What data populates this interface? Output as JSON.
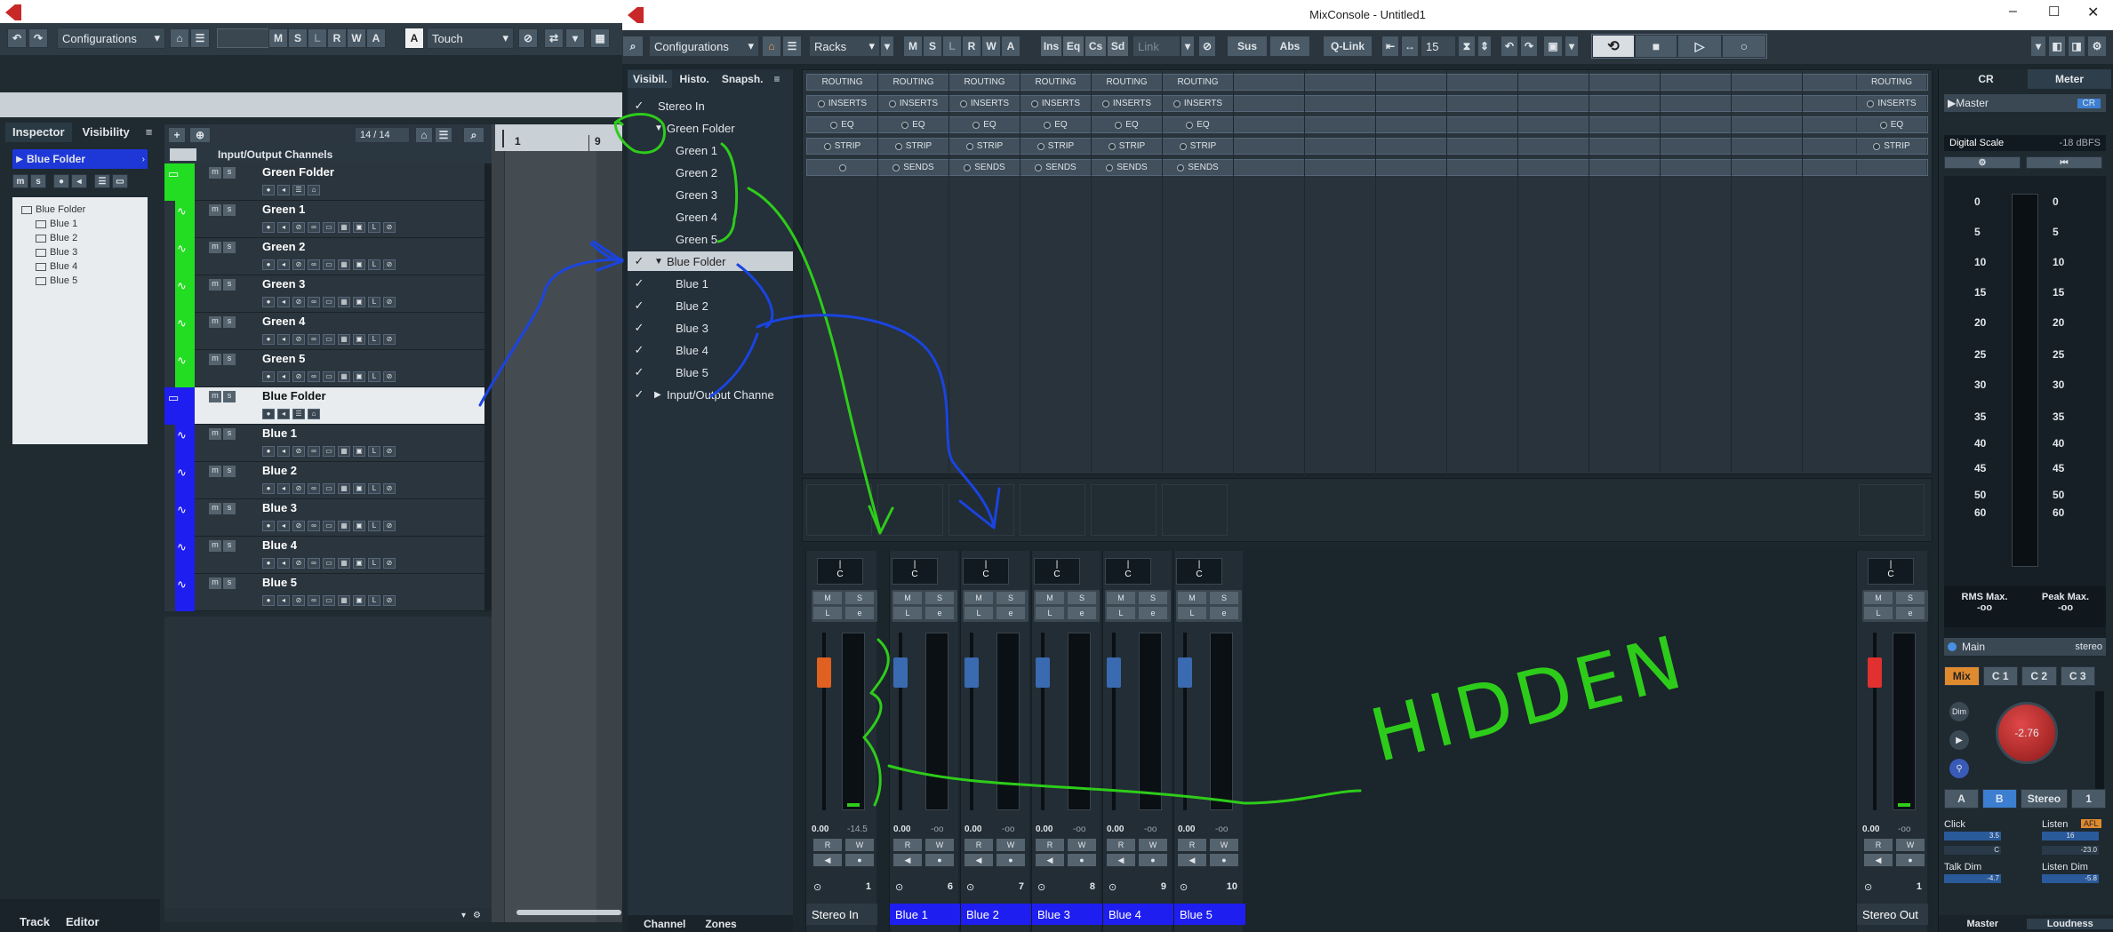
{
  "project": {
    "config_label": "Configurations",
    "automation_mode": "Touch",
    "toolbar_letters": [
      "M",
      "S",
      "L",
      "R",
      "W",
      "A"
    ],
    "inspector_tab": "Inspector",
    "visibility_tab": "Visibility",
    "selected_track": "Blue Folder",
    "tree_items": [
      "Blue Folder",
      "Blue 1",
      "Blue 2",
      "Blue 3",
      "Blue 4",
      "Blue 5"
    ],
    "track_count": "14 / 14",
    "io_channels": "Input/Output Channels",
    "ruler_marks": [
      "1",
      "9"
    ],
    "tracks": [
      {
        "name": "Green Folder",
        "color": "#22dd22",
        "folder": true
      },
      {
        "name": "Green 1",
        "color": "#22dd22"
      },
      {
        "name": "Green 2",
        "color": "#22dd22"
      },
      {
        "name": "Green 3",
        "color": "#22dd22"
      },
      {
        "name": "Green 4",
        "color": "#22dd22"
      },
      {
        "name": "Green 5",
        "color": "#22dd22"
      },
      {
        "name": "Blue Folder",
        "color": "#1e1ef0",
        "folder": true,
        "selected": true
      },
      {
        "name": "Blue 1",
        "color": "#1e1ef0"
      },
      {
        "name": "Blue 2",
        "color": "#1e1ef0"
      },
      {
        "name": "Blue 3",
        "color": "#1e1ef0"
      },
      {
        "name": "Blue 4",
        "color": "#1e1ef0"
      },
      {
        "name": "Blue 5",
        "color": "#1e1ef0"
      }
    ],
    "bottom_tabs": [
      "Track",
      "Editor"
    ]
  },
  "mixer": {
    "window_title": "MixConsole - Untitled1",
    "config_label": "Configurations",
    "racks_label": "Racks",
    "letters": [
      "M",
      "S",
      "L",
      "R",
      "W",
      "A"
    ],
    "fx_toggles": [
      "Ins",
      "Eq",
      "Cs",
      "Sd"
    ],
    "link_label": "Link",
    "sus_label": "Sus",
    "abs_label": "Abs",
    "qlink_label": "Q-Link",
    "channel_count": "15",
    "vis_tabs": [
      "Visibil.",
      "Histo.",
      "Snapsh."
    ],
    "visibility": [
      {
        "label": "Stereo In",
        "checked": true,
        "indent": 0
      },
      {
        "label": "Green Folder",
        "checked": false,
        "indent": 1,
        "folder": true
      },
      {
        "label": "Green 1",
        "checked": false,
        "indent": 2
      },
      {
        "label": "Green 2",
        "checked": false,
        "indent": 2
      },
      {
        "label": "Green 3",
        "checked": false,
        "indent": 2
      },
      {
        "label": "Green 4",
        "checked": false,
        "indent": 2
      },
      {
        "label": "Green 5",
        "checked": false,
        "indent": 2
      },
      {
        "label": "Blue Folder",
        "checked": true,
        "indent": 1,
        "folder": true,
        "selected": true
      },
      {
        "label": "Blue 1",
        "checked": true,
        "indent": 2
      },
      {
        "label": "Blue 2",
        "checked": true,
        "indent": 2
      },
      {
        "label": "Blue 3",
        "checked": true,
        "indent": 2
      },
      {
        "label": "Blue 4",
        "checked": true,
        "indent": 2
      },
      {
        "label": "Blue 5",
        "checked": true,
        "indent": 2
      },
      {
        "label": "Input/Output Channe",
        "checked": true,
        "indent": 1,
        "collapsed": true
      }
    ],
    "rack_rows": [
      "ROUTING",
      "INSERTS",
      "EQ",
      "STRIP",
      "SENDS"
    ],
    "channels": [
      {
        "name": "Stereo In",
        "number": "1",
        "value": "0.00",
        "peak": "-14.5",
        "fader": "#e06020",
        "label_bg": "#2e3a43"
      },
      {
        "name": "Blue 1",
        "number": "6",
        "value": "0.00",
        "peak": "-oo",
        "fader": "#3a6ab0",
        "label_bg": "#1e1ef0"
      },
      {
        "name": "Blue 2",
        "number": "7",
        "value": "0.00",
        "peak": "-oo",
        "fader": "#3a6ab0",
        "label_bg": "#1e1ef0"
      },
      {
        "name": "Blue 3",
        "number": "8",
        "value": "0.00",
        "peak": "-oo",
        "fader": "#3a6ab0",
        "label_bg": "#1e1ef0"
      },
      {
        "name": "Blue 4",
        "number": "9",
        "value": "0.00",
        "peak": "-oo",
        "fader": "#3a6ab0",
        "label_bg": "#1e1ef0"
      },
      {
        "name": "Blue 5",
        "number": "10",
        "value": "0.00",
        "peak": "-oo",
        "fader": "#3a6ab0",
        "label_bg": "#1e1ef0"
      }
    ],
    "stereo_out": {
      "name": "Stereo Out",
      "number": "1",
      "value": "0.00",
      "peak": "-oo"
    },
    "bottom_tabs": [
      "Channel",
      "Zones"
    ],
    "pan_label": "C"
  },
  "control_room": {
    "tabs": [
      "CR",
      "Meter"
    ],
    "master_label": "Master",
    "cr_badge": "CR",
    "scale_label": "Digital Scale",
    "scale_value": "-18 dBFS",
    "scale_ticks": [
      "0",
      "5",
      "10",
      "15",
      "20",
      "25",
      "30",
      "35",
      "40",
      "45",
      "50",
      "60"
    ],
    "rms_label": "RMS Max.",
    "rms_value": "-oo",
    "peak_label": "Peak Max.",
    "peak_value": "-oo",
    "main_label": "Main",
    "main_type": "stereo",
    "mix_buttons": [
      "Mix",
      "C 1",
      "C 2",
      "C 3"
    ],
    "dim_label": "Dim",
    "knob_value": "-2.76",
    "ab_buttons": [
      "A",
      "B",
      "Stereo",
      "1"
    ],
    "click_label": "Click",
    "listen_label": "Listen",
    "listen_badge": "AFL",
    "talkdim_label": "Talk Dim",
    "listendim_label": "Listen Dim",
    "click_value": "3.5",
    "click_pan": "C",
    "listen_value": "16",
    "listen_db": "-23.0",
    "talk_value": "-4.7",
    "listendim_value": "-5.8",
    "bottom_tabs": [
      "Master",
      "Loudness"
    ]
  },
  "annotation": {
    "text": "HIDDEN"
  }
}
